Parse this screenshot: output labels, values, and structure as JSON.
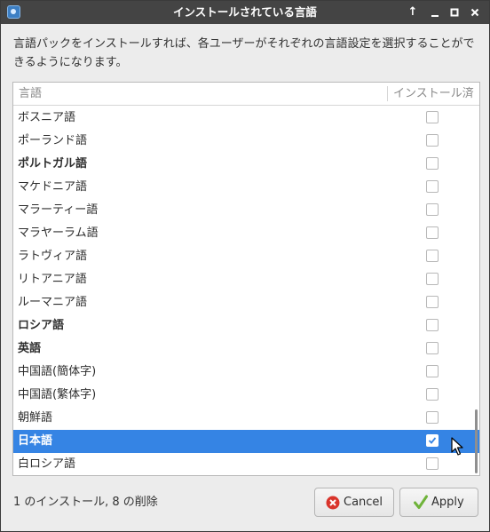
{
  "window": {
    "title": "インストールされている言語",
    "controls": {
      "keep_above": "↑",
      "minimize": "minimize-icon",
      "maximize": "maximize-icon",
      "close": "close-icon"
    }
  },
  "description": "言語パックをインストールすれば、各ユーザーがそれぞれの言語設定を選択することができるようになります。",
  "list": {
    "columns": [
      "言語",
      "インストール済"
    ],
    "rows": [
      {
        "name": "ボスニア語",
        "bold": false,
        "installed": false,
        "selected": false
      },
      {
        "name": "ポーランド語",
        "bold": false,
        "installed": false,
        "selected": false
      },
      {
        "name": "ポルトガル語",
        "bold": true,
        "installed": false,
        "selected": false
      },
      {
        "name": "マケドニア語",
        "bold": false,
        "installed": false,
        "selected": false
      },
      {
        "name": "マラーティー語",
        "bold": false,
        "installed": false,
        "selected": false
      },
      {
        "name": "マラヤーラム語",
        "bold": false,
        "installed": false,
        "selected": false
      },
      {
        "name": "ラトヴィア語",
        "bold": false,
        "installed": false,
        "selected": false
      },
      {
        "name": "リトアニア語",
        "bold": false,
        "installed": false,
        "selected": false
      },
      {
        "name": "ルーマニア語",
        "bold": false,
        "installed": false,
        "selected": false
      },
      {
        "name": "ロシア語",
        "bold": true,
        "installed": false,
        "selected": false
      },
      {
        "name": "英語",
        "bold": true,
        "installed": false,
        "selected": false
      },
      {
        "name": "中国語(簡体字)",
        "bold": false,
        "installed": false,
        "selected": false
      },
      {
        "name": "中国語(繁体字)",
        "bold": false,
        "installed": false,
        "selected": false
      },
      {
        "name": "朝鮮語",
        "bold": false,
        "installed": false,
        "selected": false
      },
      {
        "name": "日本語",
        "bold": true,
        "installed": true,
        "selected": true
      },
      {
        "name": "白ロシア語",
        "bold": false,
        "installed": false,
        "selected": false
      }
    ]
  },
  "status": "1 のインストール, 8 の削除",
  "buttons": {
    "cancel": "Cancel",
    "apply": "Apply"
  },
  "colors": {
    "selection": "#3584e4",
    "titlebar": "#444444",
    "cancel_icon": "#d9342b",
    "apply_icon": "#6fb33a"
  }
}
